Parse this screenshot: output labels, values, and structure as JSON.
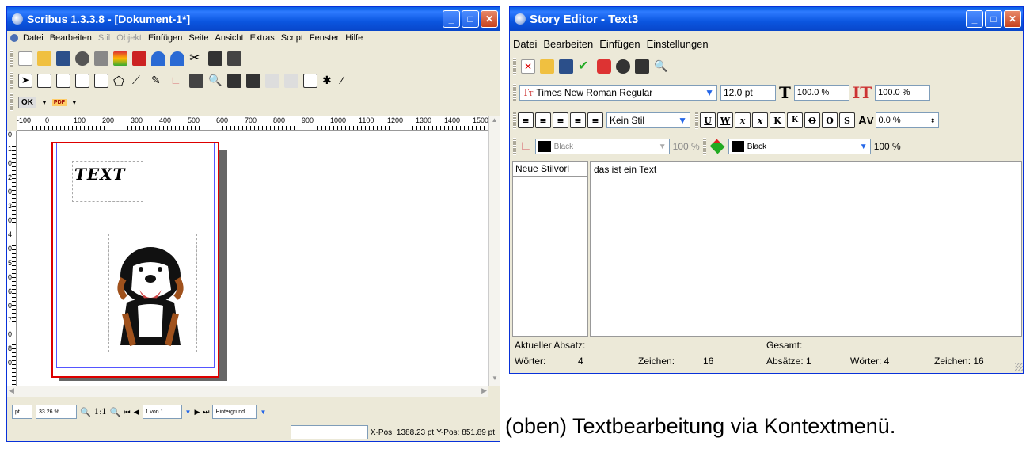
{
  "scribus": {
    "title": "Scribus 1.3.3.8 - [Dokument-1*]",
    "menu": [
      "Datei",
      "Bearbeiten",
      "Stil",
      "Objekt",
      "Einfügen",
      "Seite",
      "Ansicht",
      "Extras",
      "Script",
      "Fenster",
      "Hilfe"
    ],
    "ruler_labels": [
      "-100",
      "0",
      "100",
      "200",
      "300",
      "400",
      "500",
      "600",
      "700",
      "800",
      "900",
      "1000",
      "1100",
      "1200",
      "1300",
      "1400",
      "1500"
    ],
    "vruler_labels": [
      "0",
      "1",
      "0",
      "2",
      "0",
      "3",
      "0",
      "4",
      "0",
      "5",
      "0",
      "6",
      "0",
      "7",
      "0",
      "8",
      "0"
    ],
    "page_text": "TEXT",
    "ok_button": "OK",
    "pdf_button": "PDF",
    "unit": "pt",
    "zoom": "33.26 %",
    "zoom_ratio": "1:1",
    "page_nav": "1 von 1",
    "layer": "Hintergrund",
    "xpos_label": "X-Pos:",
    "xpos_value": "1388.23 pt",
    "ypos_label": "Y-Pos:",
    "ypos_value": "851.89 pt"
  },
  "story_editor": {
    "title": "Story Editor - Text3",
    "menu": [
      "Datei",
      "Bearbeiten",
      "Einfügen",
      "Einstellungen"
    ],
    "font": "Times New Roman Regular",
    "font_size": "12.0 pt",
    "scale_h": "100.0 %",
    "scale_v": "100.0 %",
    "style": "Kein Stil",
    "tracking": "0.0 %",
    "stroke_color": "Black",
    "stroke_shade": "100 %",
    "fill_color": "Black",
    "fill_shade": "100 %",
    "style_column": "Neue Stilvorl",
    "text": "das ist ein Text",
    "current_paragraph_label": "Aktueller Absatz:",
    "words_label": "Wörter:",
    "words_value": "4",
    "chars_label": "Zeichen:",
    "chars_value": "16",
    "total_label": "Gesamt:",
    "paragraphs_total": "Absätze: 1",
    "words_total": "Wörter: 4",
    "chars_total": "Zeichen: 16",
    "format_buttons": [
      "U",
      "W",
      "x",
      "x",
      "K",
      "K",
      "O",
      "O",
      "S"
    ]
  },
  "caption": "(oben) Textbearbeitung via Kontextmenü."
}
